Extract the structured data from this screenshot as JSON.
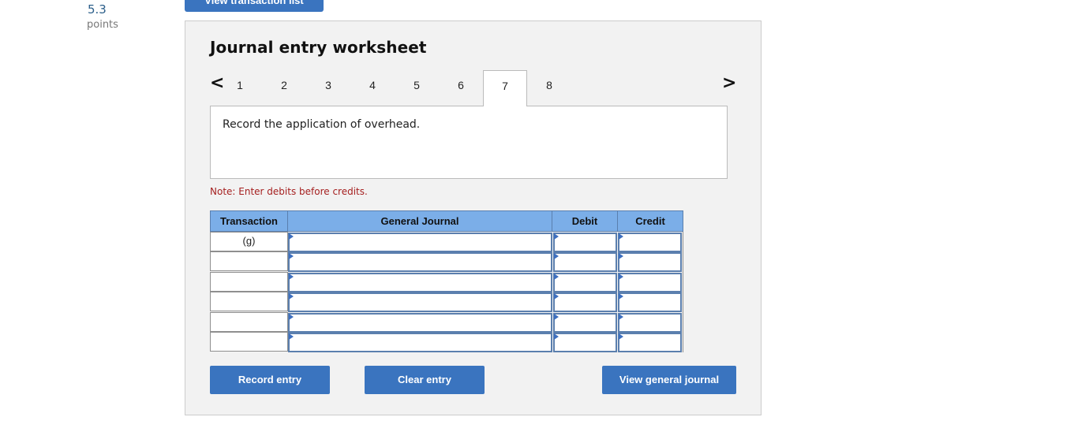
{
  "points": {
    "value": "5.3",
    "label": "points"
  },
  "top_button": {
    "label": "View transaction list"
  },
  "worksheet": {
    "title": "Journal entry worksheet",
    "tabs": [
      "1",
      "2",
      "3",
      "4",
      "5",
      "6",
      "7",
      "8"
    ],
    "active_tab": "7",
    "prompt": "Record the application of overhead.",
    "note": "Note: Enter debits before credits."
  },
  "table": {
    "headers": {
      "transaction": "Transaction",
      "general_journal": "General Journal",
      "debit": "Debit",
      "credit": "Credit"
    },
    "rows": [
      {
        "transaction": "(g)",
        "account": "",
        "debit": "",
        "credit": ""
      },
      {
        "transaction": "",
        "account": "",
        "debit": "",
        "credit": ""
      },
      {
        "transaction": "",
        "account": "",
        "debit": "",
        "credit": ""
      },
      {
        "transaction": "",
        "account": "",
        "debit": "",
        "credit": ""
      },
      {
        "transaction": "",
        "account": "",
        "debit": "",
        "credit": ""
      },
      {
        "transaction": "",
        "account": "",
        "debit": "",
        "credit": ""
      }
    ]
  },
  "buttons": {
    "record": "Record entry",
    "clear": "Clear entry",
    "view_journal": "View general journal"
  },
  "colors": {
    "accent": "#3a74bf",
    "header_fill": "#7baee8",
    "note_text": "#a51f1f"
  },
  "icons": {
    "prev": "chevron-left-icon",
    "next": "chevron-right-icon",
    "dropdown": "dropdown-triangle-icon"
  }
}
